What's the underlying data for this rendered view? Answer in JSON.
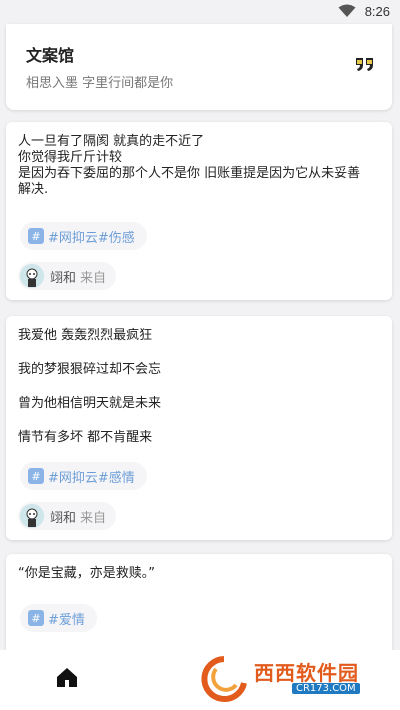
{
  "status_bar": {
    "time": "8:26",
    "wifi_icon": "wifi-icon"
  },
  "header": {
    "title": "文案馆",
    "subtitle": "相思入墨 字里行间都是你",
    "quote_icon": "quote-icon"
  },
  "posts": [
    {
      "lines": [
        "人一旦有了隔阂 就真的走不近了",
        "你觉得我斤斤计较",
        "是因为吞下委屈的那个人不是你 旧账重提是因为它从未妥善",
        "解决."
      ],
      "tag": "#网抑云#伤感",
      "author": {
        "name": "翊和",
        "from": "来自"
      }
    },
    {
      "lines": [
        "我爱他 轰轰烈烈最疯狂",
        "我的梦狠狠碎过却不会忘",
        "曾为他相信明天就是未来",
        "情节有多坏 都不肯醒来"
      ],
      "tag": "#网抑云#感情",
      "author": {
        "name": "翊和",
        "from": "来自"
      }
    },
    {
      "lines": [
        "“你是宝藏，亦是救赎。”"
      ],
      "tag": "#爱情"
    }
  ],
  "bottom_nav": {
    "home_icon": "home-icon"
  },
  "watermark": {
    "text": "西西软件园",
    "url": "CR173.COM"
  },
  "colors": {
    "tag_text": "#6d9ed8",
    "tag_hash_bg": "#8ab4e6",
    "watermark": "#e25b1c"
  }
}
